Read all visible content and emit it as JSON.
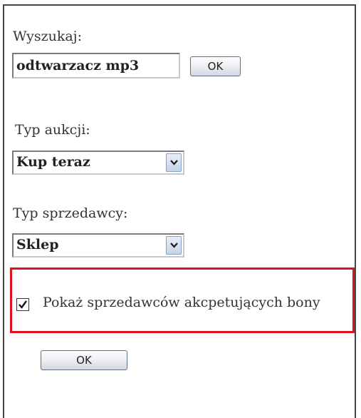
{
  "search": {
    "label": "Wyszukaj:",
    "value": "odtwarzacz mp3",
    "button_label": "OK"
  },
  "auction_type": {
    "label": "Typ aukcji:",
    "selected": "Kup teraz"
  },
  "seller_type": {
    "label": "Typ sprzedawcy:",
    "selected": "Sklep"
  },
  "vouchers": {
    "label": "Pokaż sprzedawców akcpetujących bony",
    "checked": true
  },
  "submit": {
    "label": "OK"
  },
  "colors": {
    "highlight_border": "#e0121d",
    "panel_border": "#444444"
  },
  "icons": {
    "dropdown": "chevron-down-icon",
    "checkbox": "check-icon"
  }
}
